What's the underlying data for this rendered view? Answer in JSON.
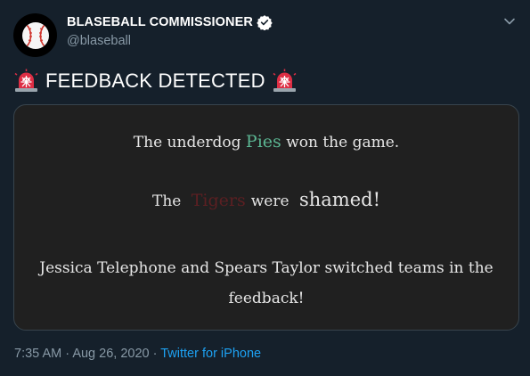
{
  "author": {
    "name": "BLASEBALL COMMISSIONER",
    "handle": "@blaseball",
    "avatar_icon": "baseball-icon",
    "verified_icon": "verified-badge-icon"
  },
  "menu_icon": "chevron-down-icon",
  "tweet": {
    "text": "FEEDBACK DETECTED",
    "emoji_icon": "rotating-light-icon"
  },
  "card": {
    "line1_before": "The underdog",
    "line1_team": "Pies",
    "line1_after": "won the game.",
    "line2_before": "The",
    "line2_team": "Tigers",
    "line2_middle": "were",
    "line2_after": "shamed!",
    "line3": "Jessica Telephone and Spears Taylor switched teams in the feedback!",
    "pies_color": "#5bb592",
    "tigers_color": "#5c1f22"
  },
  "meta": {
    "time": "7:35 AM",
    "separator1": "·",
    "date": "Aug 26, 2020",
    "separator2": "·",
    "source": "Twitter for iPhone"
  },
  "colors": {
    "background": "#15202b",
    "secondary_text": "#8899a6",
    "link": "#1da1f2",
    "card_bg": "#202020"
  }
}
